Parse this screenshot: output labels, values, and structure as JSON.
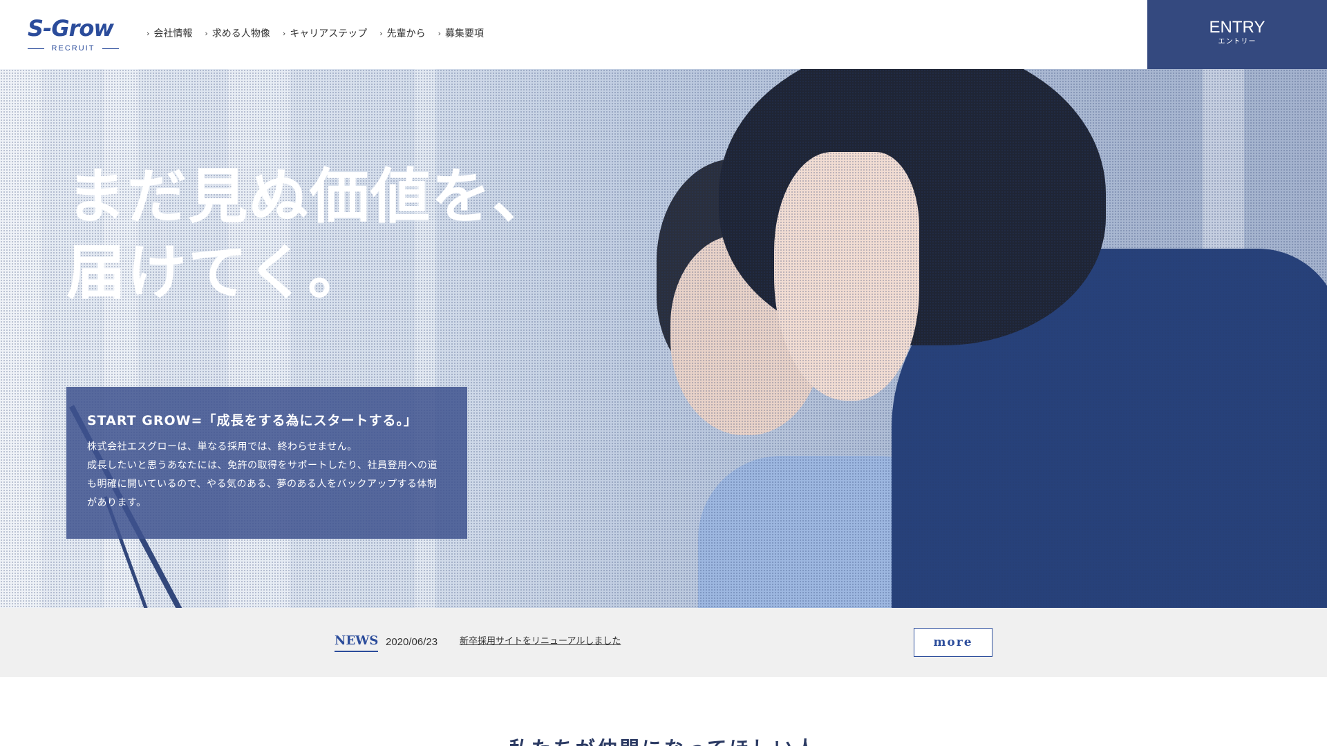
{
  "header": {
    "logo": {
      "main": "S-Grow",
      "sub": "RECRUIT"
    },
    "nav": [
      {
        "label": "会社情報"
      },
      {
        "label": "求める人物像"
      },
      {
        "label": "キャリアステップ"
      },
      {
        "label": "先輩から"
      },
      {
        "label": "募集要項"
      }
    ],
    "entry": {
      "label": "ENTRY",
      "sub": "エントリー"
    }
  },
  "hero": {
    "headline": [
      "まだ見ぬ価値を、",
      "届けてく。"
    ],
    "info": {
      "title": "START GROW=「成長をする為にスタートする。」",
      "body": [
        "株式会社エスグローは、単なる採用では、終わらせません。",
        "成長したいと思うあなたには、免許の取得をサポートしたり、社員登用への道",
        "も明確に開いているので、やる気のある、夢のある人をバックアップする体制",
        "があります。"
      ]
    }
  },
  "news": {
    "label": "NEWS",
    "date": "2020/06/23",
    "text": "新卒採用サイトをリニューアルしました",
    "more": "more"
  },
  "section": {
    "title": "私たちが仲間になってほしい人"
  },
  "colors": {
    "brand": "#2b4c9b",
    "entry_bg": "#34497f",
    "info_box": "#3e528e",
    "news_bg": "#f0f0f0"
  }
}
